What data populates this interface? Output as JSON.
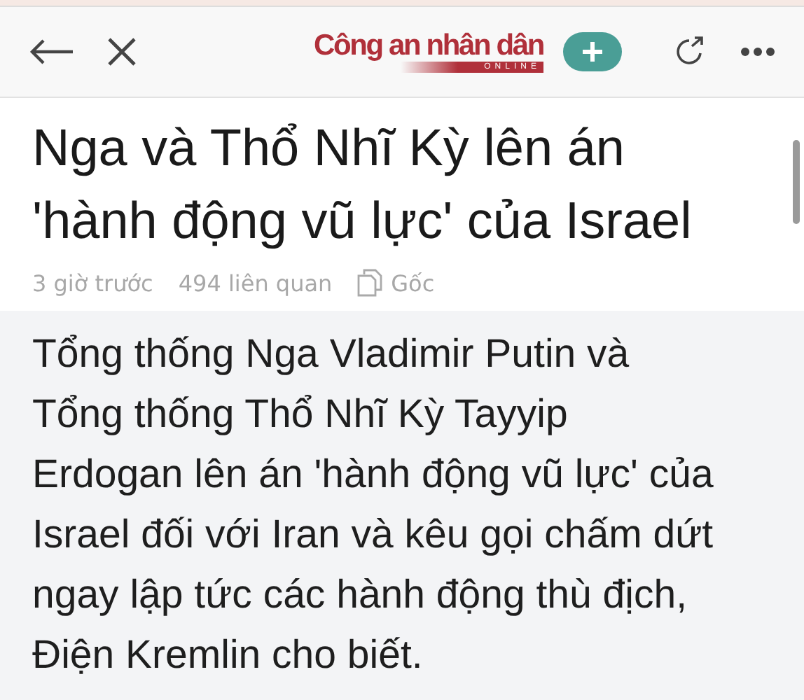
{
  "toolbar": {
    "logo": {
      "name": "Công an nhân dân",
      "subtitle": "ONLINE"
    }
  },
  "article": {
    "title": "Nga và Thổ Nhĩ Kỳ lên án 'hành động vũ lực' của Israel",
    "meta": {
      "time": "3 giờ trước",
      "related": "494 liên quan",
      "source": "Gốc"
    },
    "summary": "Tổng thống Nga Vladimir Putin và Tổng thống Thổ Nhĩ Kỳ Tayyip Erdogan lên án 'hành động vũ lực' của Israel đối với Iran và kêu gọi chấm dứt ngay lập tức các hành động thù địch, Điện Kremlin cho biết."
  }
}
